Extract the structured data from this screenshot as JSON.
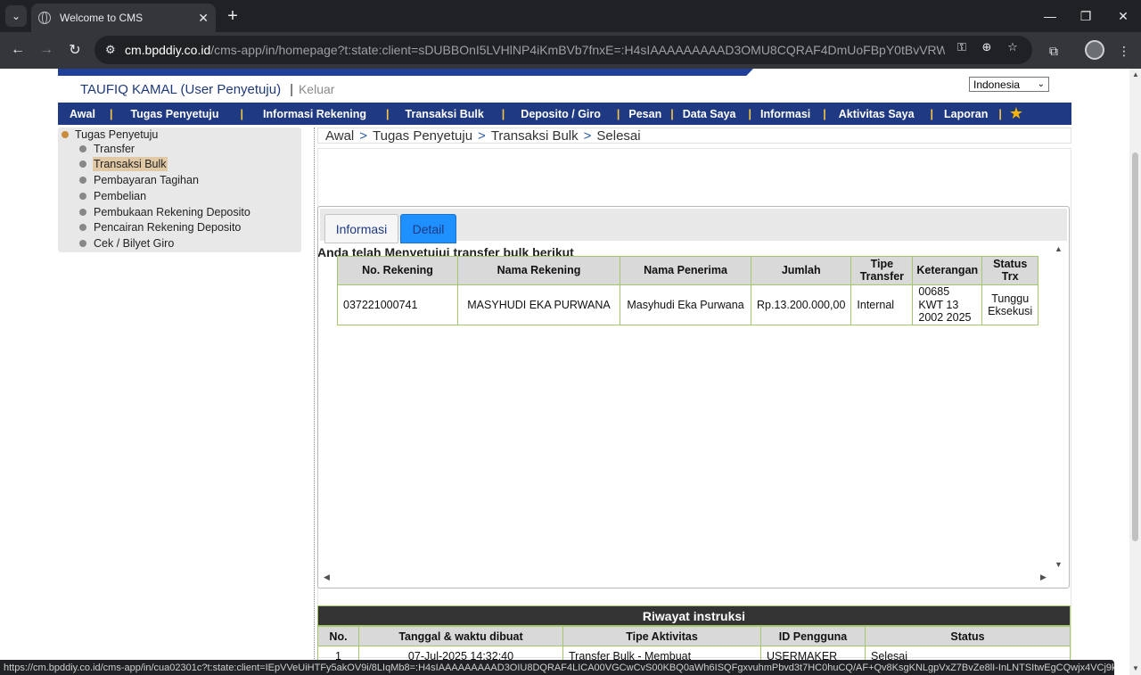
{
  "browser": {
    "tab_title": "Welcome to CMS",
    "url_host": "cm.bpddiy.co.id",
    "url_path": "/cms-app/in/homepage?t:state:client=sDUBBOnI5LVHlNP4iKmBVb7fnxE=:H4sIAAAAAAAAAD3OMU8CQRAF4DmUoFBpY0tBvVRWdJAYCBdjghXd5G48...",
    "status_url": "https://cm.bpddiy.co.id/cms-app/in/cua02301c?t:state:client=IEpVVeUiHTFy5akOV9i/8LIqMb8=:H4sIAAAAAAAAAD3OIU8DQRAF4LICA00VGCwCvS00KBQ0aWh6ISQFgxvuhmPbvd3t7HC0huCQ/AF+Qv8KsgKNLgpVxZ7BvZe8lI-InLNTSItwEgCQwjx4VCj9kjKUFPQXhxqr..."
  },
  "header": {
    "user_name": "TAUFIQ KAMAL (User Penyetuju)",
    "separator": "|",
    "logout": "Keluar",
    "language": "Indonesia"
  },
  "nav": {
    "items": [
      "Awal",
      "Tugas Penyetuju",
      "Informasi Rekening",
      "Transaksi Bulk",
      "Deposito / Giro",
      "Pesan",
      "Data Saya",
      "Informasi",
      "Aktivitas Saya",
      "Laporan"
    ],
    "separator": "|",
    "favorite_icon": "star-icon"
  },
  "sidebar": {
    "root": "Tugas Penyetuju",
    "items": [
      "Transfer",
      "Transaksi Bulk",
      "Pembayaran Tagihan",
      "Pembelian",
      "Pembukaan Rekening Deposito",
      "Pencairan Rekening Deposito",
      "Cek / Bilyet Giro"
    ],
    "active": "Transaksi Bulk"
  },
  "breadcrumb": {
    "parts": [
      "Awal",
      "Tugas Penyetuju",
      "Transaksi Bulk",
      "Selesai"
    ],
    "separator": ">"
  },
  "page": {
    "heading": "Anda telah Menyetujui transfer bulk berikut",
    "tabs": [
      "Informasi",
      "Detail"
    ],
    "active_tab": "Detail"
  },
  "detail_table": {
    "headers": [
      "No. Rekening",
      "Nama Rekening",
      "Nama Penerima",
      "Jumlah",
      "Tipe Transfer",
      "Keterangan",
      "Status Trx"
    ],
    "row": {
      "no_rekening": "037221000741",
      "nama_rekening": "MASYHUDI EKA PURWANA",
      "nama_penerima": "Masyhudi Eka Purwana",
      "jumlah": "Rp.13.200.000,00",
      "tipe_transfer": "Internal",
      "keterangan": "00685 KWT 13 2002 2025",
      "status_trx": "Tunggu Eksekusi"
    }
  },
  "history": {
    "title": "Riwayat instruksi",
    "headers": [
      "No.",
      "Tanggal & waktu dibuat",
      "Tipe Aktivitas",
      "ID Pengguna",
      "Status"
    ],
    "row": {
      "no": "1",
      "tanggal": "07-Jul-2025 14:32:40",
      "tipe": "Transfer Bulk - Membuat",
      "id": "USERMAKER",
      "status": "Selesai"
    }
  }
}
